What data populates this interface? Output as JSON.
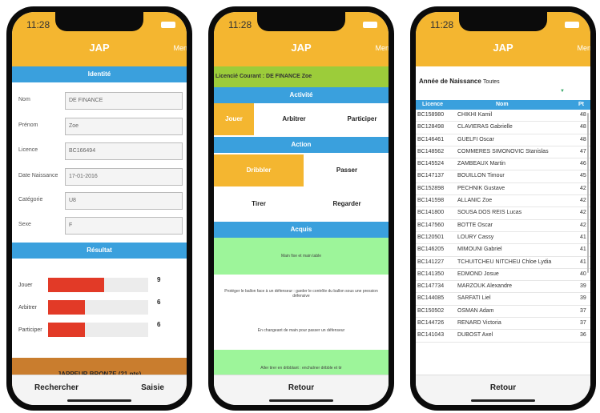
{
  "app": {
    "time": "11:28",
    "title": "JAP",
    "menu": "Menu"
  },
  "phone1": {
    "identity_header": "Identité",
    "fields": [
      {
        "label": "Nom",
        "value": "DE FINANCE"
      },
      {
        "label": "Prénom",
        "value": "Zoe"
      },
      {
        "label": "Licence",
        "value": "BC166494"
      },
      {
        "label": "Date Naissance",
        "value": "17-01-2016"
      },
      {
        "label": "Catégorie",
        "value": "U8"
      },
      {
        "label": "Sexe",
        "value": "F"
      }
    ],
    "result_header": "Résultat",
    "stats": [
      {
        "label": "Jouer",
        "value": "9",
        "fraction": 0.56
      },
      {
        "label": "Arbitrer",
        "value": "6",
        "fraction": 0.37
      },
      {
        "label": "Participer",
        "value": "6",
        "fraction": 0.37
      }
    ],
    "badge": "JAPPEUR BRONZE (21 pts)",
    "left_button": "Rechercher",
    "right_button": "Saisie"
  },
  "phone2": {
    "current": "Licencié Courant : DE FINANCE Zoe",
    "activity_header": "Activité",
    "activities": [
      "Jouer",
      "Arbitrer",
      "Participer"
    ],
    "action_header": "Action",
    "actions": [
      "Dribbler",
      "Passer",
      "Tirer",
      "Regarder"
    ],
    "acquis_header": "Acquis",
    "acquis": [
      "Main fixe et main table",
      "Protéger le ballon face à un défenseur : garder le contrôle du ballon sous une pression défensive",
      "En changeant de main pour passer un défenseur",
      "Aller tirer en dribblant : enchaîner dribble et tir"
    ],
    "button": "Retour"
  },
  "phone3": {
    "filter_label": "Année de Naissance",
    "filter_value": "Toutes",
    "columns": [
      "Licence",
      "Nom",
      "Pt"
    ],
    "rows": [
      [
        "BC158980",
        "CHIKHI Kamil",
        "48"
      ],
      [
        "BC128498",
        "CLAVIERAS Gabrielle",
        "48"
      ],
      [
        "BC146461",
        "GUELFI Oscar",
        "48"
      ],
      [
        "BC148562",
        "COMMERES SIMONOVIC Stanislas",
        "47"
      ],
      [
        "BC145524",
        "ZAMBEAUX Martin",
        "46"
      ],
      [
        "BC147137",
        "BOUILLON Timour",
        "45"
      ],
      [
        "BC152898",
        "PECHNIK Gustave",
        "42"
      ],
      [
        "BC141598",
        "ALLANIC Zoe",
        "42"
      ],
      [
        "BC141800",
        "SOUSA DOS REIS Lucas",
        "42"
      ],
      [
        "BC147560",
        "BOTTE Oscar",
        "42"
      ],
      [
        "BC120501",
        "LOURY Cassy",
        "41"
      ],
      [
        "BC146205",
        "MIMOUNI Gabriel",
        "41"
      ],
      [
        "BC141227",
        "TCHUITCHEU NITCHEU Chloe Lydia",
        "41"
      ],
      [
        "BC141350",
        "EDMOND Josue",
        "40"
      ],
      [
        "BC147734",
        "MARZOUK Alexandre",
        "39"
      ],
      [
        "BC144085",
        "SARFATI Liel",
        "39"
      ],
      [
        "BC150502",
        "OSMAN Adam",
        "37"
      ],
      [
        "BC144726",
        "RENARD Victoria",
        "37"
      ],
      [
        "BC141043",
        "DUBOST Axel",
        "36"
      ]
    ],
    "button": "Retour"
  }
}
